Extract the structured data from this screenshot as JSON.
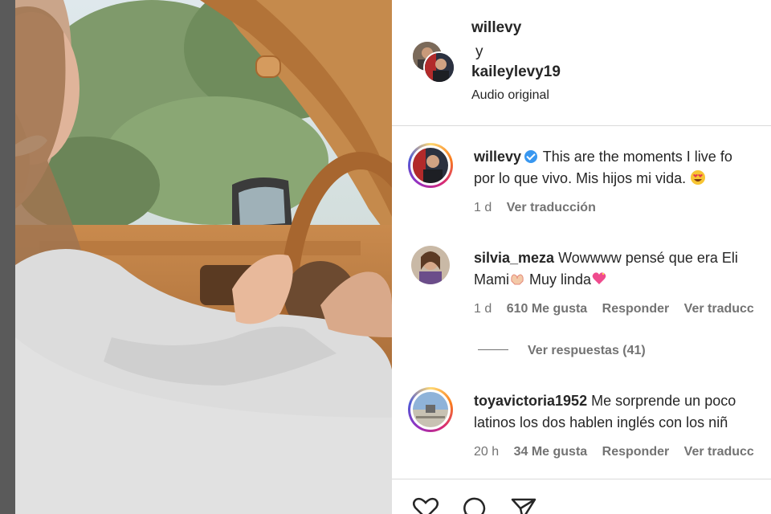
{
  "header": {
    "user1": "willevy",
    "conjunction": "y",
    "user2": "kaileylevy19",
    "audio": "Audio original"
  },
  "comments": [
    {
      "username": "willevy",
      "verified": true,
      "line1": "This are the moments I live fo",
      "line2": "por lo que vivo. Mis hijos mi vida.",
      "time": "1 d",
      "translate": "Ver traducción"
    },
    {
      "username": "silvia_meza",
      "line1": "Wowwww pensé que era Eli",
      "line2": "Mami",
      "line2b": "Muy linda",
      "time": "1 d",
      "likes": "610 Me gusta",
      "reply": "Responder",
      "translate": "Ver traducc"
    },
    {
      "username": "toyavictoria1952",
      "line1": "Me sorprende un poco",
      "line2": "latinos los dos hablen inglés con los niñ",
      "time": "20 h",
      "likes": "34 Me gusta",
      "reply": "Responder",
      "translate": "Ver traducc"
    }
  ],
  "view_replies": "Ver respuestas (41)",
  "actions": {
    "icons": [
      "heart-icon",
      "comment-icon",
      "share-icon"
    ]
  },
  "colors": {
    "text": "#262626",
    "muted": "#737373",
    "verified": "#3897f0",
    "divider": "#dbdbdb"
  }
}
